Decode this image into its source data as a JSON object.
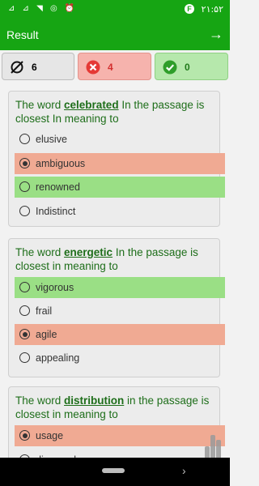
{
  "statusbar": {
    "time": "۲۱:۵۲",
    "icons_text": "⊿ ⊿ ◥ ◎ ⏰",
    "f_badge": "F"
  },
  "appbar": {
    "title": "Result",
    "forward_icon": "arrow-right-icon"
  },
  "stats": {
    "skipped": {
      "icon": "empty-set-icon",
      "count": "6"
    },
    "wrong": {
      "icon": "x-circle-icon",
      "count": "4"
    },
    "correct": {
      "icon": "check-circle-icon",
      "count": "0"
    }
  },
  "colors": {
    "primary": "#16a513",
    "wrong_bg": "#f0aa93",
    "right_bg": "#9adf85",
    "question_text": "#1e6e1a"
  },
  "questions": [
    {
      "prefix": "The word ",
      "word": "celebrated",
      "suffix": " In the passage is closest In meaning to",
      "options": [
        {
          "label": "elusive",
          "state": "normal",
          "selected": false
        },
        {
          "label": "ambiguous",
          "state": "wrong",
          "selected": true
        },
        {
          "label": "renowned",
          "state": "right",
          "selected": false
        },
        {
          "label": "Indistinct",
          "state": "normal",
          "selected": false
        }
      ]
    },
    {
      "prefix": "The word ",
      "word": "energetic",
      "suffix": " In the passage is closest in meaning to",
      "options": [
        {
          "label": "vigorous",
          "state": "right",
          "selected": false
        },
        {
          "label": "frail",
          "state": "normal",
          "selected": false
        },
        {
          "label": "agile",
          "state": "wrong",
          "selected": true
        },
        {
          "label": "appealing",
          "state": "normal",
          "selected": false
        }
      ]
    },
    {
      "prefix": "The word ",
      "word": "distribution",
      "suffix": " in the passage is closest in meaning to",
      "options": [
        {
          "label": "usage",
          "state": "wrong",
          "selected": true
        },
        {
          "label": "dispersal",
          "state": "normal",
          "selected": false
        }
      ]
    }
  ]
}
